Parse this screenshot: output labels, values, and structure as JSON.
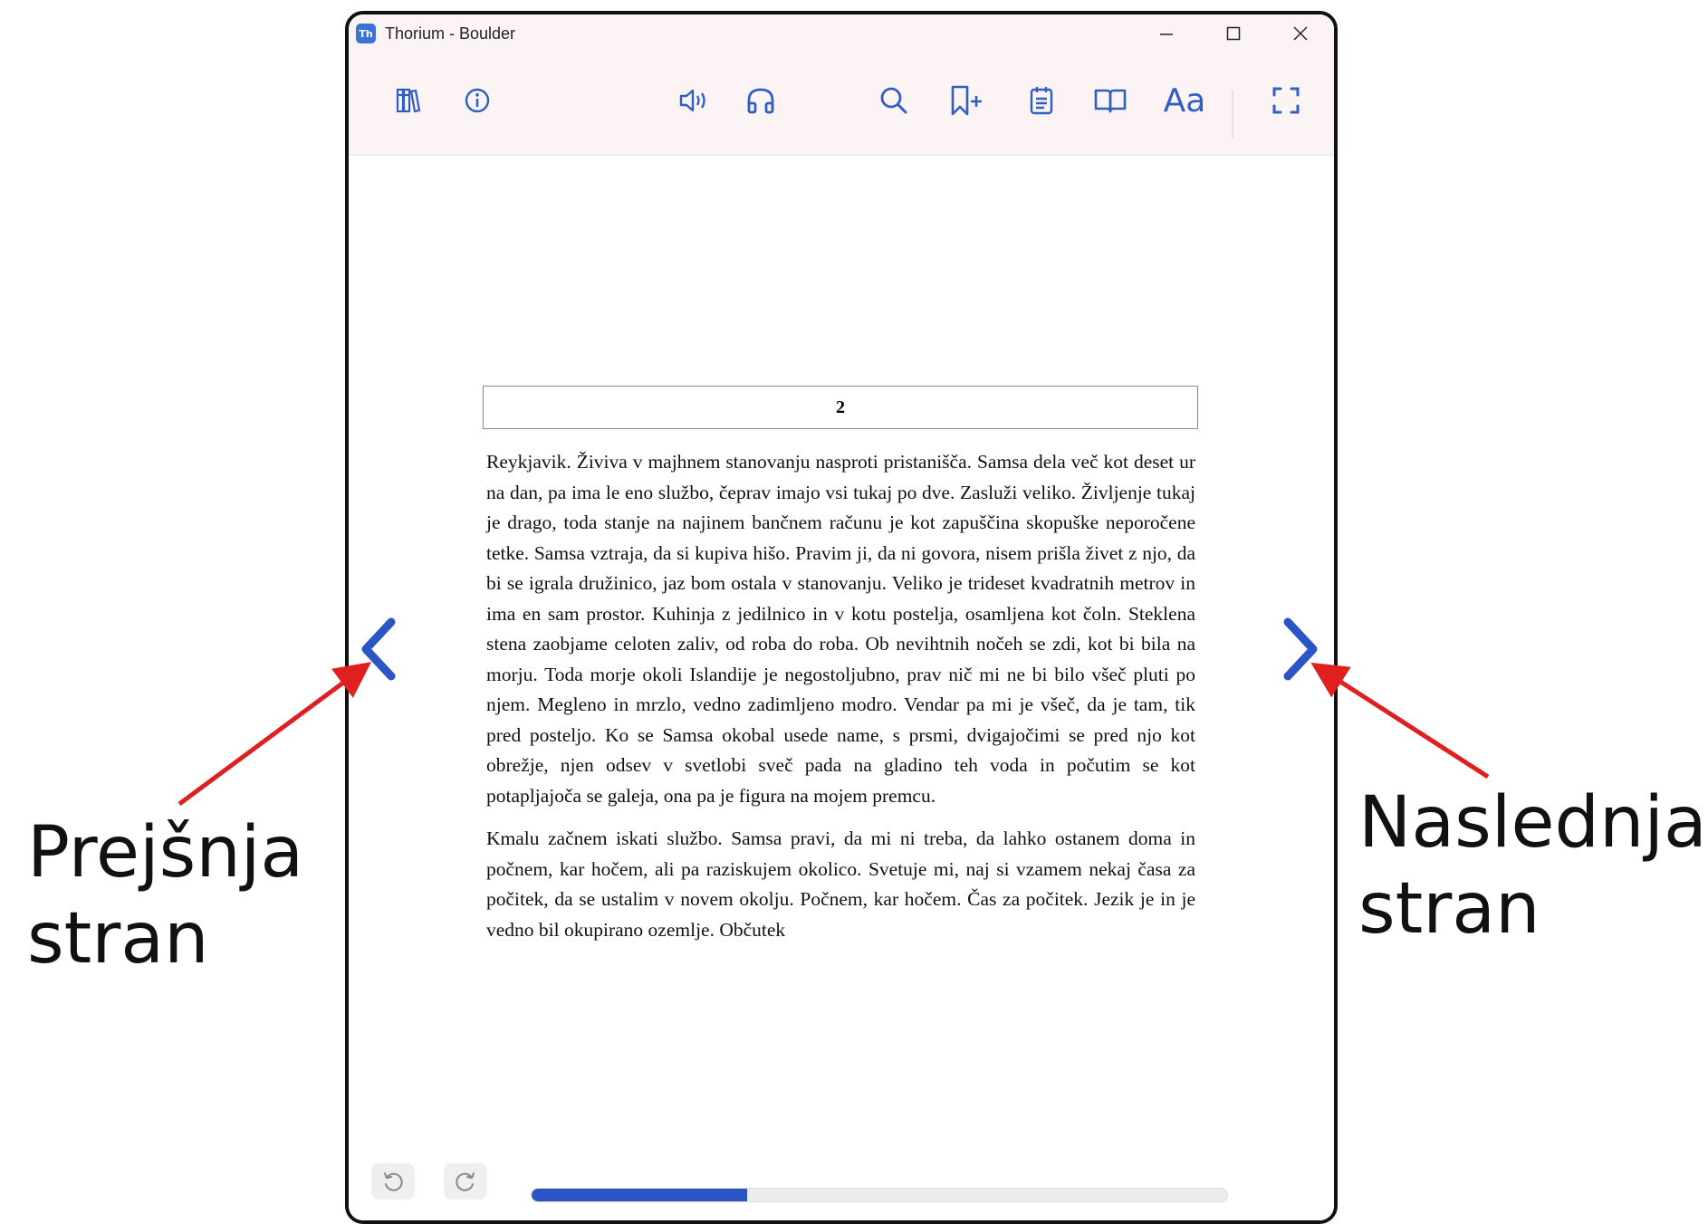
{
  "window": {
    "title": "Thorium - Boulder",
    "app_icon_label": "Th",
    "controls": [
      "minimize",
      "maximize",
      "close"
    ]
  },
  "toolbar": {
    "left_icons": [
      "library-icon",
      "info-icon"
    ],
    "center_icons": [
      "speaker-icon",
      "headphones-icon"
    ],
    "right_icons": [
      "search-icon",
      "add-bookmark-icon",
      "notes-icon",
      "toc-book-icon"
    ],
    "font_settings_label": "Aa",
    "fullscreen_icon": "fullscreen-icon"
  },
  "page": {
    "header": "2",
    "paragraphs": [
      "Reykjavik. Živiva v majhnem stanovanju nasproti pristanišča. Samsa dela več kot deset ur na dan, pa ima le eno službo, čeprav imajo vsi tukaj po dve. Zasluži veliko. Življenje tukaj je drago, toda stanje na najinem bančnem računu je kot zapuščina skopuške neporočene tetke. Samsa vztraja, da si kupiva hišo. Pravim ji, da ni govora, nisem prišla živet z njo, da bi se igrala družinico, jaz bom ostala v stanovanju. Veliko je trideset kvadratnih metrov in ima en sam prostor. Kuhinja z jedilnico in v kotu postelja, osamljena kot čoln. Steklena stena zaobjame celoten zaliv, od roba do roba. Ob nevihtnih nočeh se zdi, kot bi bila na morju. Toda morje okoli Islandije je negostoljubno, prav nič mi ne bi bilo všeč pluti po njem. Megleno in mrzlo, vedno zadimljeno modro. Vendar pa mi je všeč, da je tam, tik pred posteljo. Ko se Samsa okobal usede name, s prsmi, dvigajočimi se pred njo kot obrežje, njen odsev v svetlobi sveč pada na gladino teh voda in počutim se kot potapljajoča se galeja, ona pa je figura na mojem premcu.",
      "Kmalu začnem iskati službo. Samsa pravi, da mi ni treba, da lahko ostanem doma in počnem, kar hočem, ali pa raziskujem okolico. Svetuje mi, naj si vzamem nekaj časa za počitek, da se ustalim v novem okolju. Počnem, kar hočem. Čas za počitek. Jezik je in je vedno bil okupirano ozemlje. Občutek"
    ]
  },
  "navigation": {
    "previous_icon": "chevron-left-icon",
    "next_icon": "chevron-right-icon"
  },
  "progress": {
    "fraction": 0.31
  },
  "annotations": {
    "left_line1": "Prejšnja",
    "left_line2": "stran",
    "right_line1": "Naslednja",
    "right_line2": "stran"
  },
  "colors": {
    "accent": "#2f5fc0",
    "arrow_annotation": "#e02020",
    "titlebar_bg": "#fbf3f4",
    "progress_fill": "#2a55c4"
  }
}
